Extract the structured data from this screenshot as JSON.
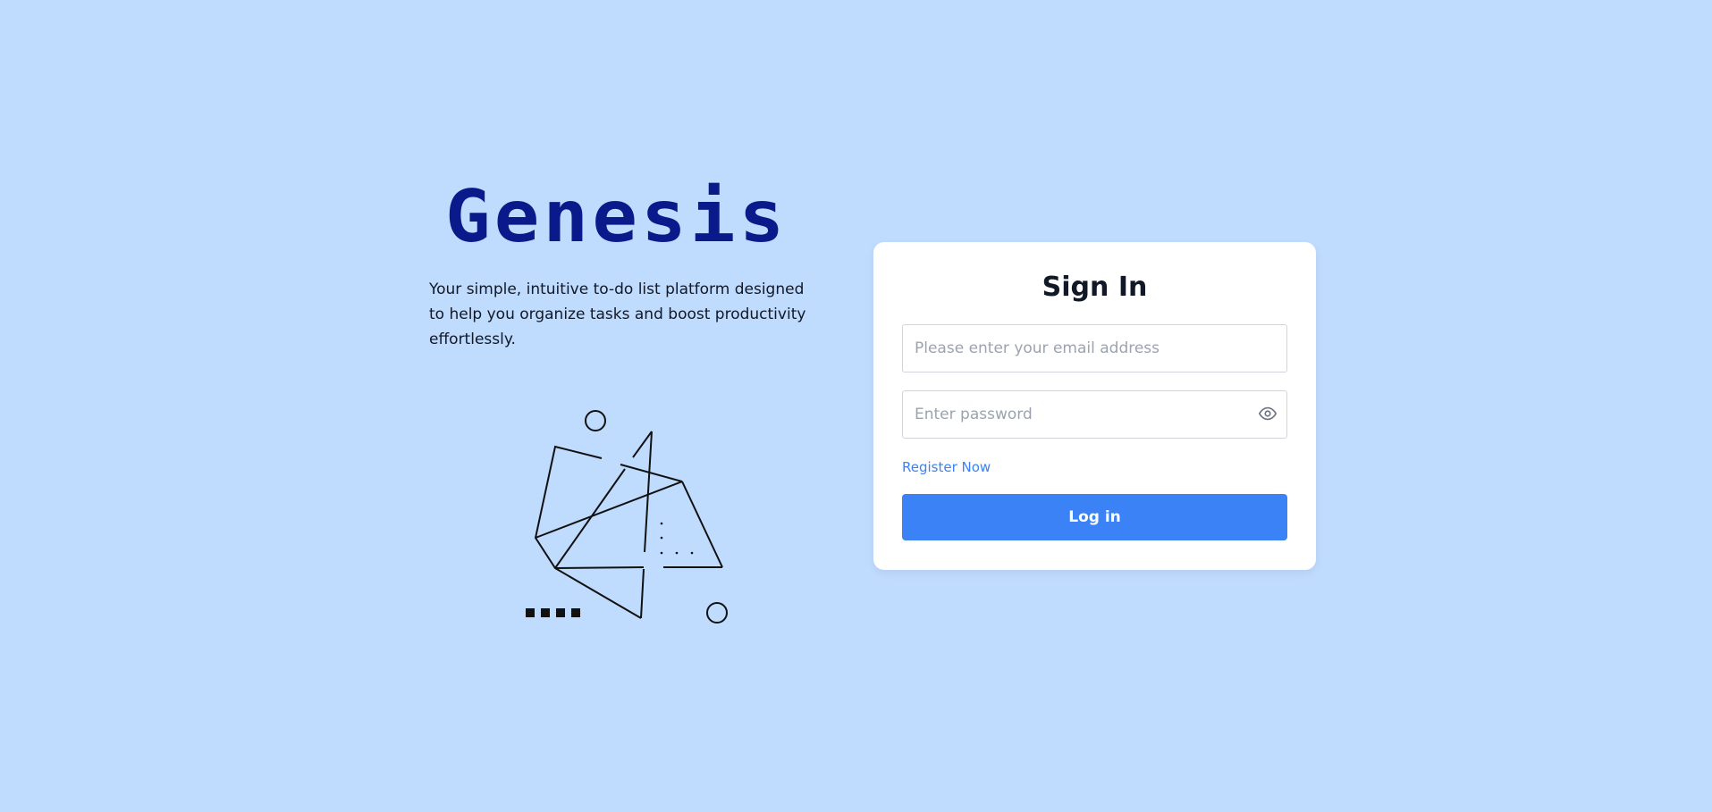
{
  "brand": {
    "logo_text": "Genesis",
    "tagline": "Your simple, intuitive to-do list platform designed to help you organize tasks and boost productivity effortlessly.",
    "logo_color": "#0b1a8a"
  },
  "signin": {
    "title": "Sign In",
    "email_placeholder": "Please enter your email address",
    "email_value": "",
    "password_placeholder": "Enter password",
    "password_value": "",
    "password_toggle_icon": "eye-icon",
    "register_link": "Register Now",
    "login_button": "Log in"
  },
  "colors": {
    "background": "#bfdbfe",
    "accent": "#3b82f6",
    "card": "#ffffff"
  }
}
